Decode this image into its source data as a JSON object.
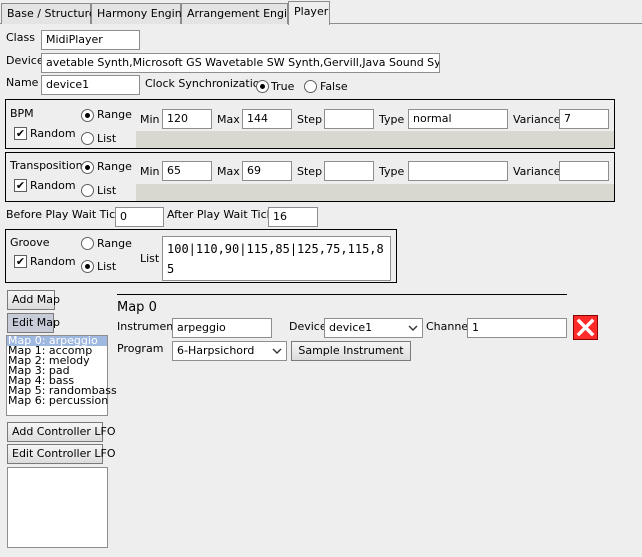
{
  "tabs": [
    {
      "label": "Base / Structure"
    },
    {
      "label": "Harmony Engine"
    },
    {
      "label": "Arrangement Engine"
    },
    {
      "label": "Player"
    }
  ],
  "header": {
    "class_label": "Class",
    "class_value": "MidiPlayer",
    "device_label": "Device",
    "device_value": "avetable Synth,Microsoft GS Wavetable SW Synth,Gervill,Java Sound Synthesizer",
    "name_label": "Name",
    "name_value": "device1",
    "clock_label": "Clock Synchronization",
    "clock_true": "True",
    "clock_false": "False"
  },
  "bpm": {
    "title": "BPM",
    "random": "Random",
    "range": "Range",
    "list": "List",
    "min_label": "Min",
    "min": "120",
    "max_label": "Max",
    "max": "144",
    "step_label": "Step",
    "step": "",
    "type_label": "Type",
    "type": "normal",
    "variance_label": "Variance",
    "variance": "7"
  },
  "transposition": {
    "title": "Transposition",
    "random": "Random",
    "range": "Range",
    "list": "List",
    "min_label": "Min",
    "min": "65",
    "max_label": "Max",
    "max": "69",
    "step_label": "Step",
    "step": "",
    "type_label": "Type",
    "type": "",
    "variance_label": "Variance",
    "variance": ""
  },
  "wait": {
    "before_label": "Before Play Wait Ticks",
    "before": "0",
    "after_label": "After Play Wait Ticks",
    "after": "16"
  },
  "groove": {
    "title": "Groove",
    "random": "Random",
    "range": "Range",
    "list": "List",
    "list_label": "List",
    "list_value": "100|110,90|115,85|125,75,115,85"
  },
  "maps": {
    "add_map": "Add Map",
    "edit_map": "Edit Map",
    "items": [
      "Map 0: arpeggio",
      "Map 1: accomp",
      "Map 2: melody",
      "Map 3: pad",
      "Map 4: bass",
      "Map 5: randombass",
      "Map 6: percussion"
    ],
    "add_lfo": "Add Controller LFO",
    "edit_lfo": "Edit Controller LFO"
  },
  "map_detail": {
    "title": "Map 0",
    "instrument_label": "Instrument",
    "instrument": "arpeggio",
    "device_label": "Device",
    "device": "device1",
    "channel_label": "Channel",
    "channel": "1",
    "program_label": "Program",
    "program": "6-Harpsichord",
    "sample_button": "Sample Instrument"
  },
  "colors": {
    "accent": "#9fb8e0",
    "delete": "#ff2a2a"
  }
}
